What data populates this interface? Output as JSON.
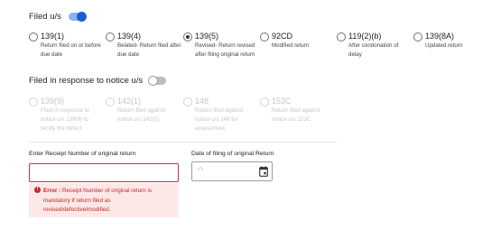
{
  "filed": {
    "title": "Filed u/s",
    "toggle_on": true,
    "options": [
      {
        "label": "139(1)",
        "desc": "Return filed on or before due date",
        "checked": false
      },
      {
        "label": "139(4)",
        "desc": "Belated- Return filed after due date",
        "checked": false
      },
      {
        "label": "139(5)",
        "desc": "Revised- Return revised after filing original return",
        "checked": true
      },
      {
        "label": "92CD",
        "desc": "Modified return",
        "checked": false
      },
      {
        "label": "119(2)(b)",
        "desc": "After condonation of delay",
        "checked": false
      },
      {
        "label": "139(8A)",
        "desc": "Updated return",
        "checked": false
      }
    ]
  },
  "notice": {
    "title": "Filed in response to notice u/s",
    "toggle_on": false,
    "options": [
      {
        "label": "139(9)",
        "desc": "Filed in response to notice u/s 139(9) to rectify the defect"
      },
      {
        "label": "142(1)",
        "desc": "Return filed against notice u/s 142(1)"
      },
      {
        "label": "148",
        "desc": "Return filed against notice u/s 148 for assessment"
      },
      {
        "label": "153C",
        "desc": "Return filed against notice u/s 153C"
      }
    ]
  },
  "receipt": {
    "label": "Enter Receipt Number of original return",
    "value": ""
  },
  "date": {
    "label": "Date of filing of original Return",
    "placeholder": "-'-"
  },
  "error": {
    "title": "Error :",
    "message": "Receipt Number of original return is mandatory if return filed as revised/defective/modified."
  },
  "colors": {
    "accent": "#1a5dcf",
    "error": "#c62828",
    "error_bg": "#fde8e8"
  }
}
